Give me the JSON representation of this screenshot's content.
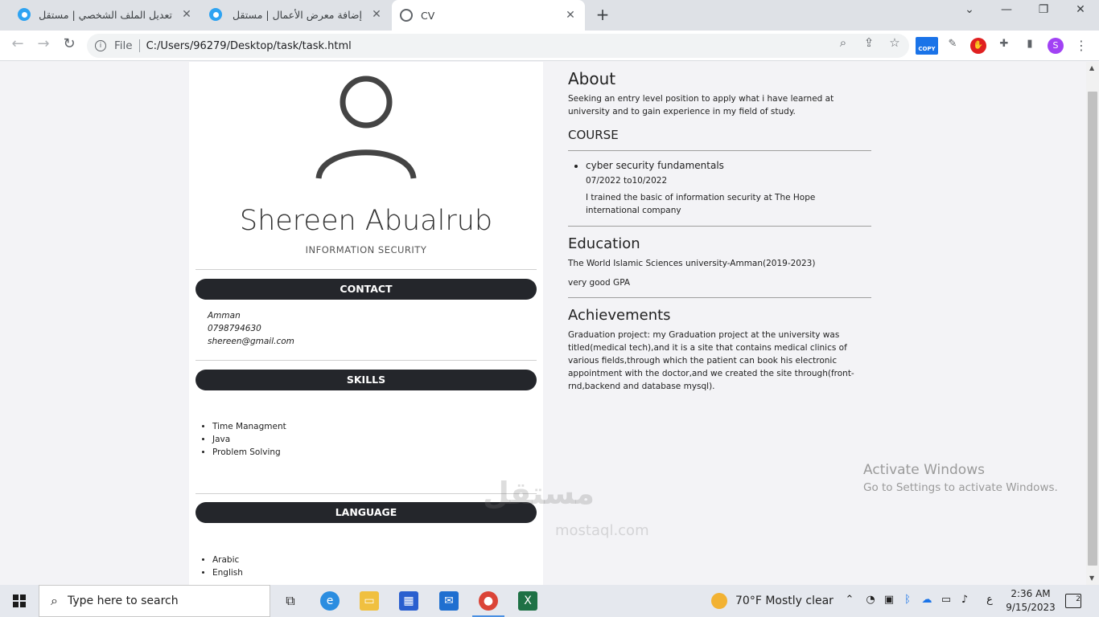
{
  "browser": {
    "tabs": [
      {
        "title": "تعديل الملف الشخصي | مستقل",
        "close": "✕"
      },
      {
        "title": "إضافة معرض الأعمال | مستقل",
        "close": "✕"
      },
      {
        "title": "CV",
        "close": "✕"
      }
    ],
    "new_tab": "+",
    "window_controls": {
      "minimize": "—",
      "maximize": "❐",
      "close": "✕",
      "tab_search": "⌄"
    },
    "address": {
      "scheme_label": "File",
      "url": "C:/Users/96279/Desktop/task/task.html"
    },
    "extensions": {
      "copy_label": "COPY",
      "stop_label": "✋",
      "profile_initial": "S"
    }
  },
  "cv": {
    "name": "Shereen Abualrub",
    "role": "INFORMATION SECURITY",
    "contact": {
      "heading": "CONTACT",
      "city": "Amman",
      "phone": "0798794630",
      "email": "shereen@gmail.com"
    },
    "skills": {
      "heading": "SKILLS",
      "items": [
        "Time Managment",
        "Java",
        "Problem Solving"
      ]
    },
    "language": {
      "heading": "LANGUAGE",
      "items": [
        "Arabic",
        "English"
      ]
    },
    "about": {
      "heading": "About",
      "text": "Seeking an entry level position to apply what i have learned at university and to gain experience in my field of study."
    },
    "course": {
      "heading": "COURSE",
      "title": "cyber security fundamentals",
      "dates": "07/2022 to10/2022",
      "description": "I trained the basic of information security at The Hope international company"
    },
    "education": {
      "heading": "Education",
      "school": "The World Islamic Sciences university-Amman(2019-2023)",
      "gpa": "very good GPA"
    },
    "achievements": {
      "heading": "Achievements",
      "text": "Graduation project: my Graduation project at the university was titled(medical tech),and it is a site that contains medical clinics of various fields,through which the patient can book his electronic appointment with the doctor,and we created the site through(front-rnd,backend and database mysql)."
    }
  },
  "overlay": {
    "activate_title": "Activate Windows",
    "activate_sub": "Go to Settings to activate Windows.",
    "watermark": "مستقل",
    "watermark_url": "mostaql.com"
  },
  "taskbar": {
    "search_placeholder": "Type here to search",
    "weather": "70°F  Mostly clear",
    "lang": "ع",
    "time": "2:36 AM",
    "date": "9/15/2023",
    "notifications": "2"
  }
}
